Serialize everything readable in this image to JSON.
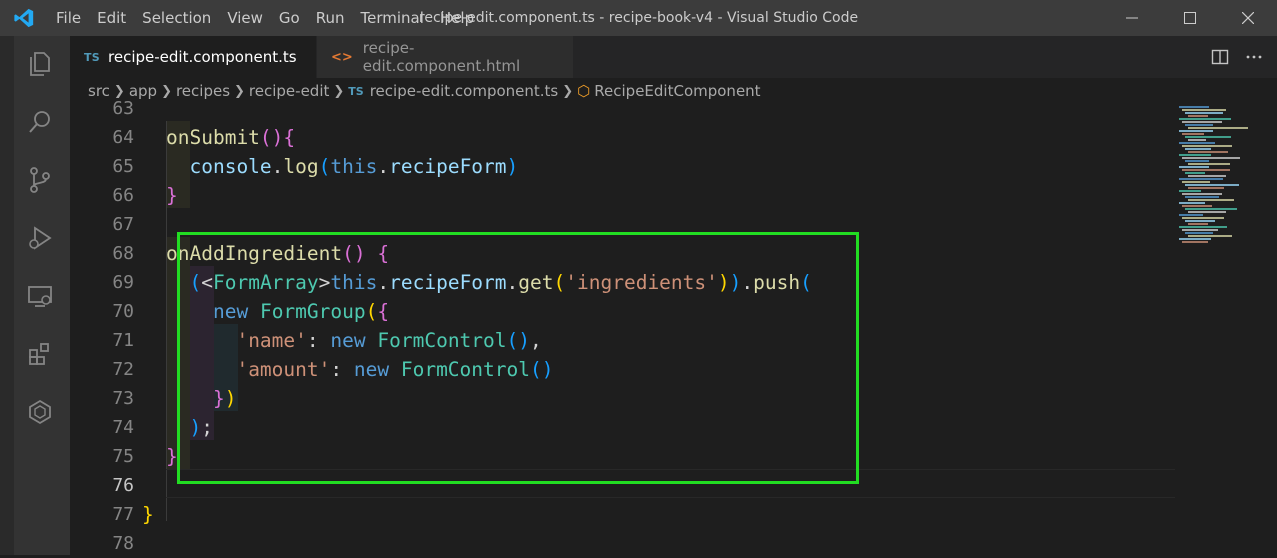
{
  "window": {
    "title": "recipe-edit.component.ts - recipe-book-v4 - Visual Studio Code"
  },
  "menu": [
    "File",
    "Edit",
    "Selection",
    "View",
    "Go",
    "Run",
    "Terminal",
    "Help"
  ],
  "tabs": [
    {
      "badge": "TS",
      "label": "recipe-edit.component.ts",
      "active": true
    },
    {
      "badge": "<>",
      "label": "recipe-edit.component.html",
      "active": false
    }
  ],
  "breadcrumb": {
    "parts": [
      "src",
      "app",
      "recipes",
      "recipe-edit"
    ],
    "file_badge": "TS",
    "file": "recipe-edit.component.ts",
    "symbol": "RecipeEditComponent"
  },
  "editor": {
    "current_line": "76",
    "line_numbers": [
      "63",
      "64",
      "65",
      "66",
      "67",
      "68",
      "69",
      "70",
      "71",
      "72",
      "73",
      "74",
      "75",
      "76",
      "77",
      "78"
    ]
  },
  "colors": {
    "highlight_border": "#22dd22",
    "keyword": "#569cd6",
    "function": "#dcdcaa",
    "type": "#4ec9b0",
    "string": "#ce9178"
  }
}
